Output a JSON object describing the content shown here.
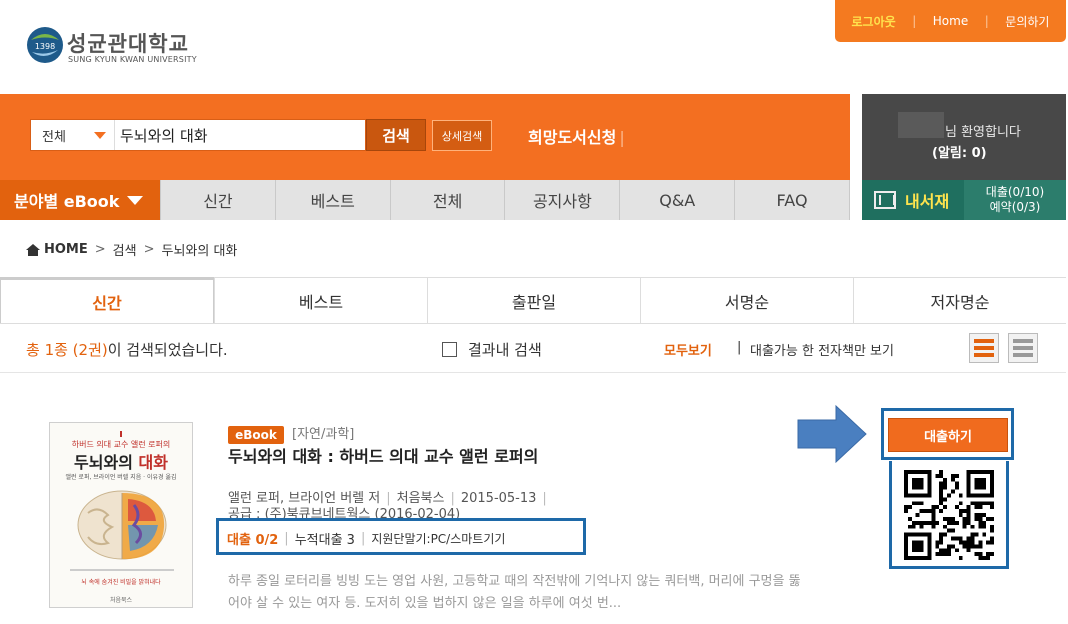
{
  "top_links": {
    "logout": "로그아웃",
    "home": "Home",
    "inquiry": "문의하기",
    "separator": "|"
  },
  "logo": {
    "mark_text": "1398",
    "name": "성균관대학교",
    "english": "SUNG KYUN KWAN UNIVERSITY"
  },
  "search": {
    "scope": "전체",
    "query": "두뇌와의 대화",
    "button": "검색",
    "advanced": "상세검색",
    "hope_request": "희망도서신청"
  },
  "nav": {
    "category_button": "분야별 eBook",
    "tabs": [
      "신간",
      "베스트",
      "전체",
      "공지사항",
      "Q&A",
      "FAQ"
    ]
  },
  "user": {
    "welcome": "님 환영합니다",
    "alert": "(알림: 0)",
    "shelf": "내서재",
    "loans": "대출(0/10)",
    "reservations": "예약(0/3)"
  },
  "breadcrumb": {
    "home": "HOME",
    "items": [
      "검색",
      "두뇌와의 대화"
    ],
    "separator": ">"
  },
  "sort_tabs": [
    "신간",
    "베스트",
    "출판일",
    "서명순",
    "저자명순"
  ],
  "results": {
    "total_highlight": "총 1종 (2권)",
    "total_suffix": "이 검색되었습니다.",
    "within_label": "결과내 검색",
    "view_all": "모두보기",
    "view_separator": "|",
    "view_available": "대출가능 한 전자책만 보기"
  },
  "book": {
    "badge": "eBook",
    "category": "[자연/과학]",
    "title": "두뇌와의 대화 : 하버드 의대 교수 앨런 로퍼의",
    "author": "앨런 로퍼, 브라이언 버렐 저",
    "publisher": "처음북스",
    "date": "2015-05-13",
    "supply": "공급 : (주)북큐브네트웍스 (2016-02-04)",
    "loan_status": "대출 0/2",
    "cumulative": "누적대출 3",
    "devices": "지원단말기:PC/스마트기기",
    "description": "하루 종일 로터리를 빙빙 도는 영업 사원, 고등학교 때의 작전밖에 기억나지 않는 쿼터백, 머리에 구멍을 뚫어야 살 수 있는 여자 등. 도저히 있을 법하지 않은 일을 하루에 여섯 번...",
    "loan_button": "대출하기",
    "cover": {
      "top": "하버드 의대 교수 앨런 로퍼의",
      "title_a": "두뇌와의 ",
      "title_b": "대화",
      "authors": "앨런 로퍼, 브라이언 버렐 지음 · 이유경 옮김",
      "tagline": "뇌 속에 숨겨진 비밀을 밝혀내다",
      "publisher": "처음북스"
    }
  },
  "colors": {
    "brand_orange": "#f36f21",
    "highlight_blue": "#1e69a8",
    "panel_dark": "#484848",
    "shelf_green": "#1f6f5f"
  }
}
